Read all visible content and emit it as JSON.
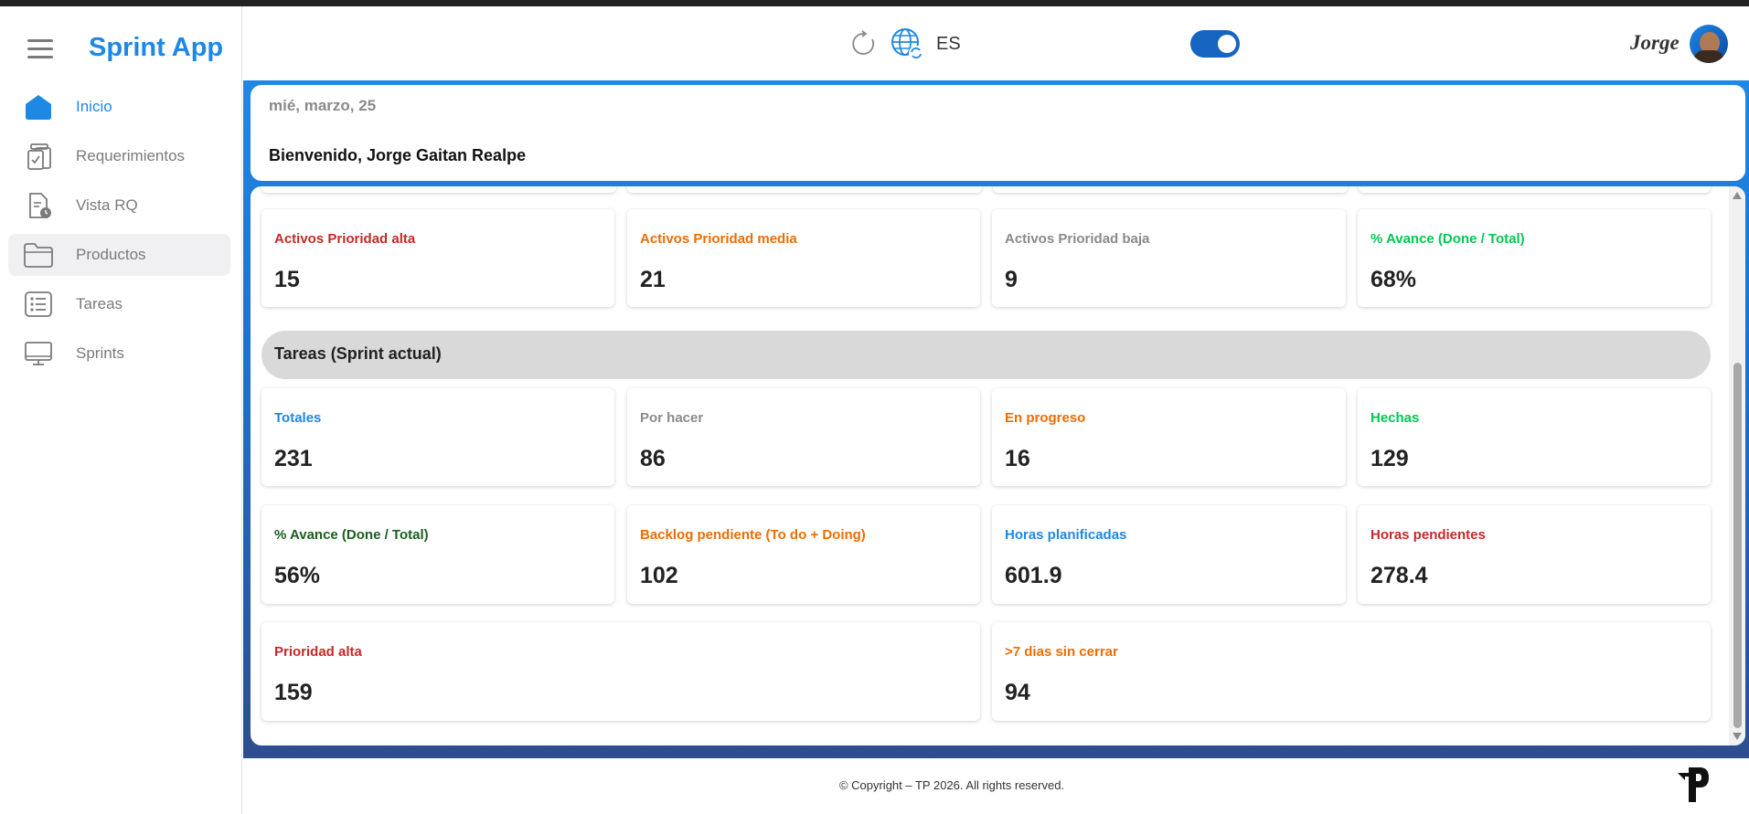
{
  "app": {
    "title": "Sprint App"
  },
  "sidebar": {
    "items": [
      {
        "label": "Inicio",
        "icon": "home-icon",
        "active": true
      },
      {
        "label": "Requerimientos",
        "icon": "clipboard-check-icon"
      },
      {
        "label": "Vista RQ",
        "icon": "document-clock-icon"
      },
      {
        "label": "Productos",
        "icon": "folder-icon"
      },
      {
        "label": "Tareas",
        "icon": "list-icon"
      },
      {
        "label": "Sprints",
        "icon": "monitor-icon"
      }
    ]
  },
  "header": {
    "language": "ES",
    "theme_toggle_on": true,
    "user_name": "Jorge"
  },
  "welcome": {
    "date": "mié, marzo, 25",
    "greeting": "Bienvenido, Jorge Gaitan Realpe"
  },
  "rq_stats": [
    {
      "label": "Activos Prioridad alta",
      "value": "15",
      "color": "#c62828"
    },
    {
      "label": "Activos Prioridad media",
      "value": "21",
      "color": "#ef6c00"
    },
    {
      "label": "Activos Prioridad baja",
      "value": "9",
      "color": "#8a8a8a"
    },
    {
      "label": "% Avance (Done / Total)",
      "value": "68%",
      "color": "#00c853"
    }
  ],
  "tasks_section": {
    "title": "Tareas (Sprint actual)"
  },
  "task_stats_row1": [
    {
      "label": "Totales",
      "value": "231",
      "color": "#1e88e5"
    },
    {
      "label": "Por hacer",
      "value": "86",
      "color": "#8a8a8a"
    },
    {
      "label": "En progreso",
      "value": "16",
      "color": "#ef6c00"
    },
    {
      "label": "Hechas",
      "value": "129",
      "color": "#00c853"
    }
  ],
  "task_stats_row2": [
    {
      "label": "% Avance (Done / Total)",
      "value": "56%",
      "color": "#1b5e20"
    },
    {
      "label": "Backlog pendiente (To do + Doing)",
      "value": "102",
      "color": "#ef6c00"
    },
    {
      "label": "Horas planificadas",
      "value": "601.9",
      "color": "#1e88e5"
    },
    {
      "label": "Horas pendientes",
      "value": "278.4",
      "color": "#c62828"
    }
  ],
  "task_stats_row3": [
    {
      "label": "Prioridad alta",
      "value": "159",
      "color": "#c62828"
    },
    {
      "label": ">7 dias sin cerrar",
      "value": "94",
      "color": "#ef6c00"
    }
  ],
  "footer": {
    "copyright": "© Copyright – TP 2026. All rights reserved."
  }
}
